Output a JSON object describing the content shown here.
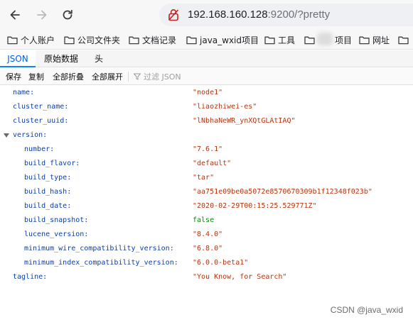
{
  "browser": {
    "url_host": "192.168.160.128",
    "url_rest": ":9200/?pretty"
  },
  "bookmarks": [
    {
      "label": "个人账户"
    },
    {
      "label": "公司文件夹"
    },
    {
      "label": "文档记录"
    },
    {
      "label": "java_wxid项目"
    },
    {
      "label": "工具"
    },
    {
      "label": "项目"
    },
    {
      "label": "网址"
    }
  ],
  "viewer": {
    "tabs": [
      {
        "label": "JSON",
        "active": true
      },
      {
        "label": "原始数据",
        "active": false
      },
      {
        "label": "头",
        "active": false
      }
    ],
    "actions": {
      "save": "保存",
      "copy": "复制",
      "collapse_all": "全部折叠",
      "expand_all": "全部展开",
      "filter_placeholder": "过滤 JSON"
    }
  },
  "json_rows": [
    {
      "key": "name:",
      "value": "\"node1\"",
      "type": "str",
      "depth": 0
    },
    {
      "key": "cluster_name:",
      "value": "\"liaozhiwei-es\"",
      "type": "str",
      "depth": 0
    },
    {
      "key": "cluster_uuid:",
      "value": "\"lNbhaNeWR_ynXQtGLAtIAQ\"",
      "type": "str",
      "depth": 0
    },
    {
      "key": "version:",
      "value": "",
      "type": "obj",
      "depth": 0
    },
    {
      "key": "number:",
      "value": "\"7.6.1\"",
      "type": "str",
      "depth": 1
    },
    {
      "key": "build_flavor:",
      "value": "\"default\"",
      "type": "str",
      "depth": 1
    },
    {
      "key": "build_type:",
      "value": "\"tar\"",
      "type": "str",
      "depth": 1
    },
    {
      "key": "build_hash:",
      "value": "\"aa751e09be0a5072e8570670309b1f12348f023b\"",
      "type": "str",
      "depth": 1
    },
    {
      "key": "build_date:",
      "value": "\"2020-02-29T00:15:25.529771Z\"",
      "type": "str",
      "depth": 1
    },
    {
      "key": "build_snapshot:",
      "value": "false",
      "type": "bool",
      "depth": 1
    },
    {
      "key": "lucene_version:",
      "value": "\"8.4.0\"",
      "type": "str",
      "depth": 1
    },
    {
      "key": "minimum_wire_compatibility_version:",
      "value": "\"6.8.0\"",
      "type": "str",
      "depth": 1
    },
    {
      "key": "minimum_index_compatibility_version:",
      "value": "\"6.0.0-beta1\"",
      "type": "str",
      "depth": 1
    },
    {
      "key": "tagline:",
      "value": "\"You Know, for Search\"",
      "type": "str",
      "depth": 0
    }
  ],
  "watermark": "CSDN @java_wxid",
  "icons": {
    "back": "arrow-left-icon",
    "forward": "arrow-right-icon",
    "reload": "reload-icon",
    "security": "not-secure-icon",
    "folder": "folder-icon",
    "filter": "filter-icon",
    "expander": "triangle-down-icon"
  }
}
